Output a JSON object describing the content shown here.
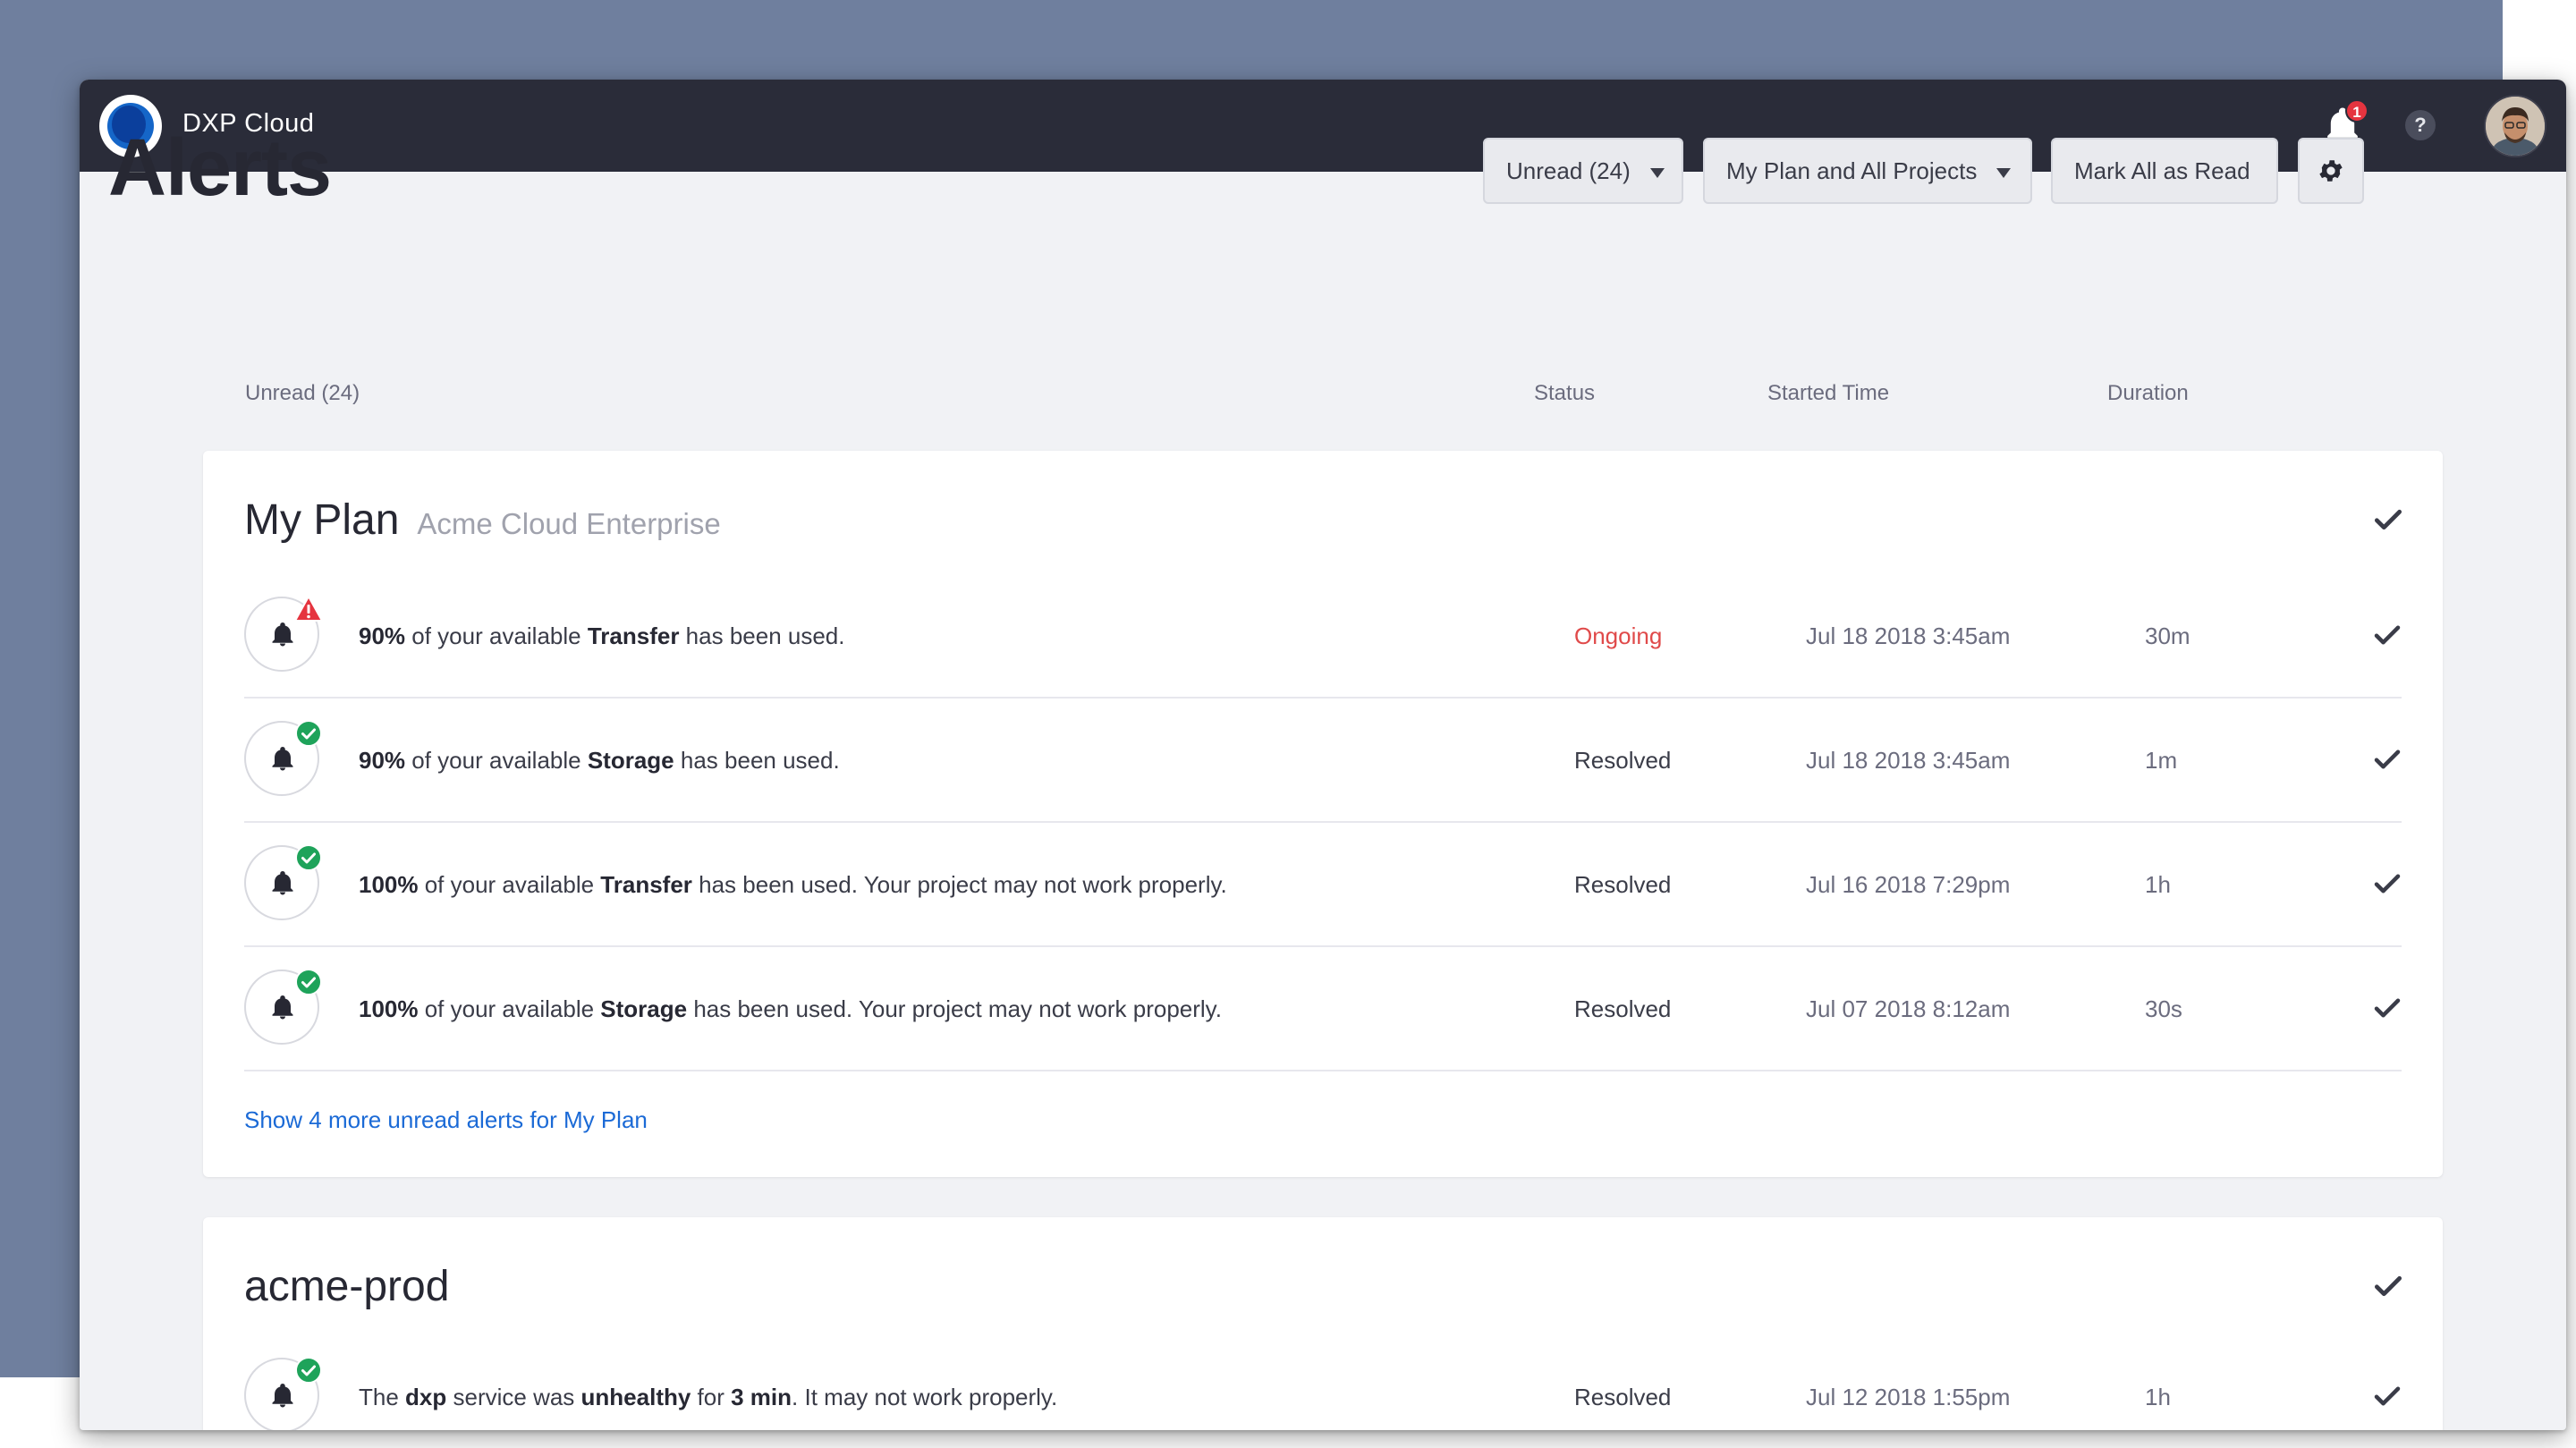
{
  "app": {
    "title": "DXP Cloud",
    "notification_count": "1",
    "help_label": "?"
  },
  "header": {
    "title": "Alerts",
    "filter_unread": "Unread (24)",
    "filter_scope": "My Plan and All Projects",
    "mark_all": "Mark All as Read"
  },
  "columns": {
    "first": "Unread (24)",
    "status": "Status",
    "started": "Started Time",
    "duration": "Duration"
  },
  "cards": [
    {
      "title": "My Plan",
      "subtitle": "Acme Cloud Enterprise",
      "show_more": "Show 4 more unread alerts for My Plan",
      "rows": [
        {
          "pct": "90%",
          "t1": " of your available ",
          "resource": "Transfer",
          "t2": " has been used.",
          "status": "Ongoing",
          "started": "Jul 18 2018 3:45am",
          "duration": "30m"
        },
        {
          "pct": "90%",
          "t1": " of your available ",
          "resource": "Storage",
          "t2": " has been used.",
          "status": "Resolved",
          "started": "Jul 18 2018 3:45am",
          "duration": "1m"
        },
        {
          "pct": "100%",
          "t1": " of your available ",
          "resource": "Transfer",
          "t2": " has been used. Your project may not work properly.",
          "status": "Resolved",
          "started": "Jul 16 2018 7:29pm",
          "duration": "1h"
        },
        {
          "pct": "100%",
          "t1": " of your available ",
          "resource": "Storage",
          "t2": " has been used. Your project may not work properly.",
          "status": "Resolved",
          "started": "Jul 07 2018 8:12am",
          "duration": "30s"
        }
      ]
    },
    {
      "title": "acme-prod",
      "rows": [
        {
          "t0": "The ",
          "svc": "dxp",
          "t1": " service was ",
          "cond": "unhealthy",
          "t2": " for ",
          "dur": "3 min",
          "t3": ". It may not work properly.",
          "status": "Resolved",
          "started": "Jul 12 2018 1:55pm",
          "duration": "1h"
        }
      ]
    }
  ],
  "colors": {
    "topbar": "#2a2c39",
    "backdrop": "#6f7f9e",
    "ongoing": "#e04a4a",
    "resolved_badge": "#1ea35a",
    "warning_badge": "#e5343f",
    "link": "#1b6ad6"
  },
  "icons": [
    "logo",
    "bell-icon",
    "help-icon",
    "avatar",
    "caret-down-icon",
    "gear-icon",
    "check-icon",
    "warning-icon",
    "resolved-icon"
  ]
}
